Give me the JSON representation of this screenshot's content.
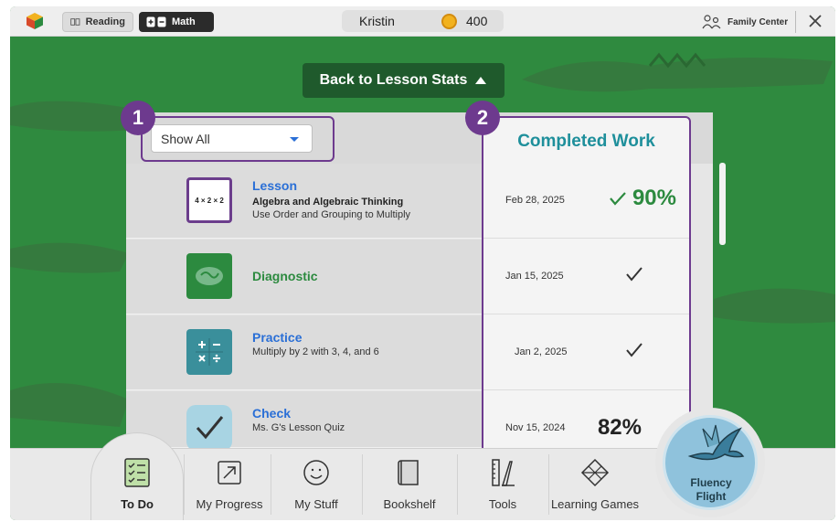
{
  "topbar": {
    "reading_label": "Reading",
    "math_label": "Math",
    "user_name": "Kristin",
    "coins": "400",
    "family_label": "Family Center"
  },
  "back_button_label": "Back to Lesson Stats",
  "filter": {
    "selected": "Show All"
  },
  "badges": [
    "1",
    "2"
  ],
  "completed_title": "Completed Work",
  "rows": [
    {
      "title": "Lesson",
      "sub1": "Algebra and Algebraic Thinking",
      "sub2": "Use Order and Grouping to Multiply",
      "date": "Feb 28, 2025",
      "score": "90%",
      "icon_text": "4 × 2 × 2",
      "icon": "lesson-card-icon"
    },
    {
      "title": "Diagnostic",
      "sub1": "",
      "sub2": "",
      "date": "Jan 15, 2025",
      "score": "",
      "icon": "brain-icon"
    },
    {
      "title": "Practice",
      "sub1": "",
      "sub2": "Multiply by 2 with 3, 4, and 6",
      "date": "Jan 2, 2025",
      "score": "",
      "icon": "operations-icon"
    },
    {
      "title": "Check",
      "sub1": "",
      "sub2": "Ms. G's Lesson Quiz",
      "date": "Nov 15, 2024",
      "score": "82%",
      "icon": "checkmark-icon"
    }
  ],
  "nav": [
    {
      "label": "To Do",
      "icon": "checklist-icon"
    },
    {
      "label": "My Progress",
      "icon": "progress-arrow-icon"
    },
    {
      "label": "My Stuff",
      "icon": "smiley-icon"
    },
    {
      "label": "Bookshelf",
      "icon": "book-icon"
    },
    {
      "label": "Tools",
      "icon": "ruler-tools-icon"
    },
    {
      "label": "Learning Games",
      "icon": "games-icon"
    }
  ],
  "fluency_label_1": "Fluency",
  "fluency_label_2": "Flight",
  "colors": {
    "accent_purple": "#6d3a8e",
    "green": "#2c8a3f",
    "teal": "#1e8f9b",
    "link_blue": "#2a6fd6"
  }
}
